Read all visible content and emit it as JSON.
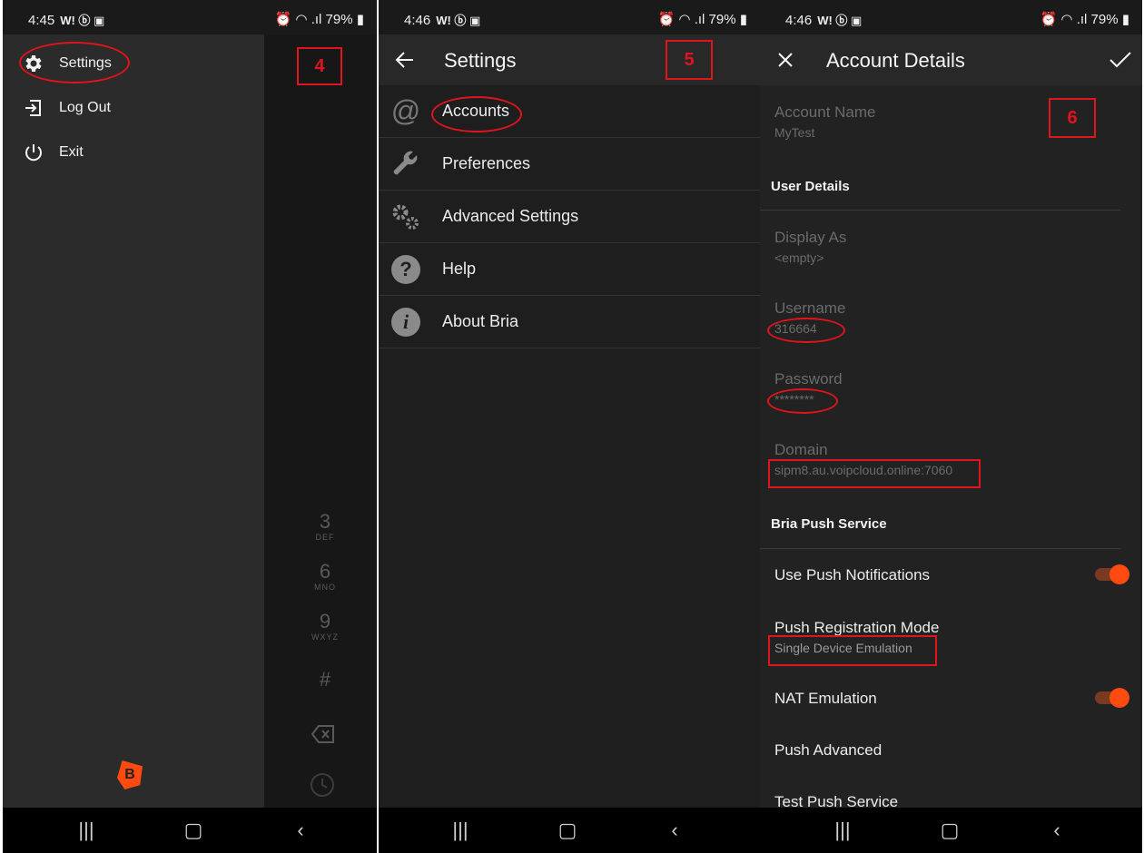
{
  "panel1": {
    "status": {
      "time": "4:45",
      "battery": "79%"
    },
    "drawer_items": [
      {
        "label": "Settings",
        "icon": "gear-icon"
      },
      {
        "label": "Log Out",
        "icon": "logout-icon"
      },
      {
        "label": "Exit",
        "icon": "power-icon"
      }
    ],
    "dialpad": [
      {
        "num": "3",
        "letters": "DEF"
      },
      {
        "num": "6",
        "letters": "MNO"
      },
      {
        "num": "9",
        "letters": "WXYZ"
      },
      {
        "num": "#",
        "letters": ""
      }
    ],
    "step_label": "4",
    "logo_letter": "B"
  },
  "panel2": {
    "status": {
      "time": "4:46",
      "battery": "79%"
    },
    "title": "Settings",
    "items": [
      {
        "label": "Accounts",
        "icon": "at-icon"
      },
      {
        "label": "Preferences",
        "icon": "wrench-icon"
      },
      {
        "label": "Advanced Settings",
        "icon": "gears-icon"
      },
      {
        "label": "Help",
        "icon": "help-icon"
      },
      {
        "label": "About Bria",
        "icon": "info-icon"
      }
    ],
    "step_label": "5"
  },
  "panel3": {
    "status": {
      "time": "4:46",
      "battery": "79%"
    },
    "title": "Account Details",
    "account_name": {
      "label": "Account Name",
      "value": "MyTest"
    },
    "section_user": "User Details",
    "display_as": {
      "label": "Display As",
      "value": "<empty>"
    },
    "username": {
      "label": "Username",
      "value": "316664"
    },
    "password": {
      "label": "Password",
      "value": "********"
    },
    "domain": {
      "label": "Domain",
      "value": "sipm8.au.voipcloud.online:7060"
    },
    "section_push": "Bria Push Service",
    "use_push": {
      "label": "Use Push Notifications",
      "enabled": true
    },
    "push_mode": {
      "label": "Push Registration Mode",
      "value": "Single Device Emulation"
    },
    "nat_emulation": {
      "label": "NAT Emulation",
      "enabled": true
    },
    "push_advanced": "Push Advanced",
    "test_push": "Test Push Service",
    "step_label": "6"
  },
  "colors": {
    "accent": "#ff4a10",
    "annotation": "#e0141b"
  }
}
